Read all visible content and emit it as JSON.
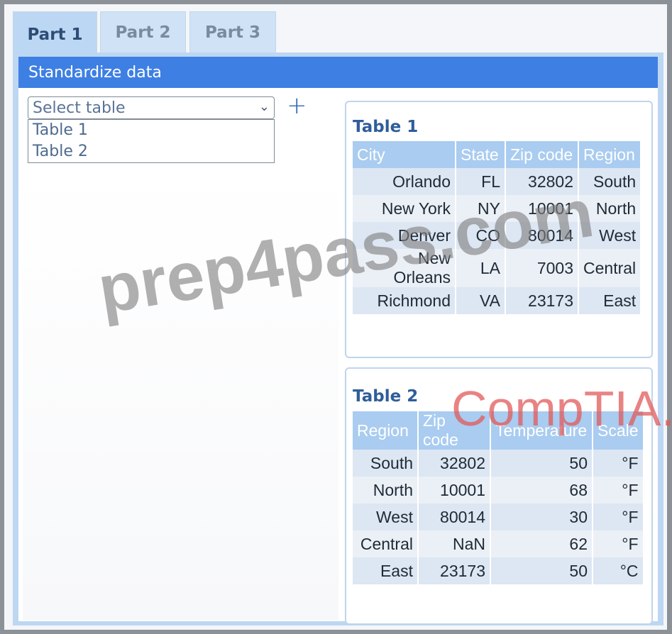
{
  "tabs": [
    {
      "label": "Part 1"
    },
    {
      "label": "Part 2"
    },
    {
      "label": "Part 3"
    }
  ],
  "header": {
    "title": "Standardize data"
  },
  "table_select": {
    "value": "Select table",
    "options": [
      "Table 1",
      "Table 2"
    ],
    "add_icon": "plus-icon",
    "chevron_icon": "chevron-down-icon"
  },
  "table1": {
    "title": "Table 1",
    "columns": [
      "City",
      "State",
      "Zip code",
      "Region"
    ],
    "rows": [
      [
        "Orlando",
        "FL",
        "32802",
        "South"
      ],
      [
        "New York",
        "NY",
        "10001",
        "North"
      ],
      [
        "Denver",
        "CO",
        "80014",
        "West"
      ],
      [
        "New Orleans",
        "LA",
        "7003",
        "Central"
      ],
      [
        "Richmond",
        "VA",
        "23173",
        "East"
      ]
    ]
  },
  "table2": {
    "title": "Table 2",
    "columns": [
      "Region",
      "Zip code",
      "Temperature",
      "Scale"
    ],
    "rows": [
      [
        "South",
        "32802",
        "50",
        "°F"
      ],
      [
        "North",
        "10001",
        "68",
        "°F"
      ],
      [
        "West",
        "80014",
        "30",
        "°F"
      ],
      [
        "Central",
        "NaN",
        "62",
        "°F"
      ],
      [
        "East",
        "23173",
        "50",
        "°C"
      ]
    ]
  },
  "watermarks": {
    "site": "prep4pass.com",
    "brand": "CompTIA."
  },
  "colors": {
    "accent": "#3e7fe3",
    "tab_active": "#bcd7f4",
    "table_header": "#a9ccf0",
    "title": "#2f5d9a"
  }
}
